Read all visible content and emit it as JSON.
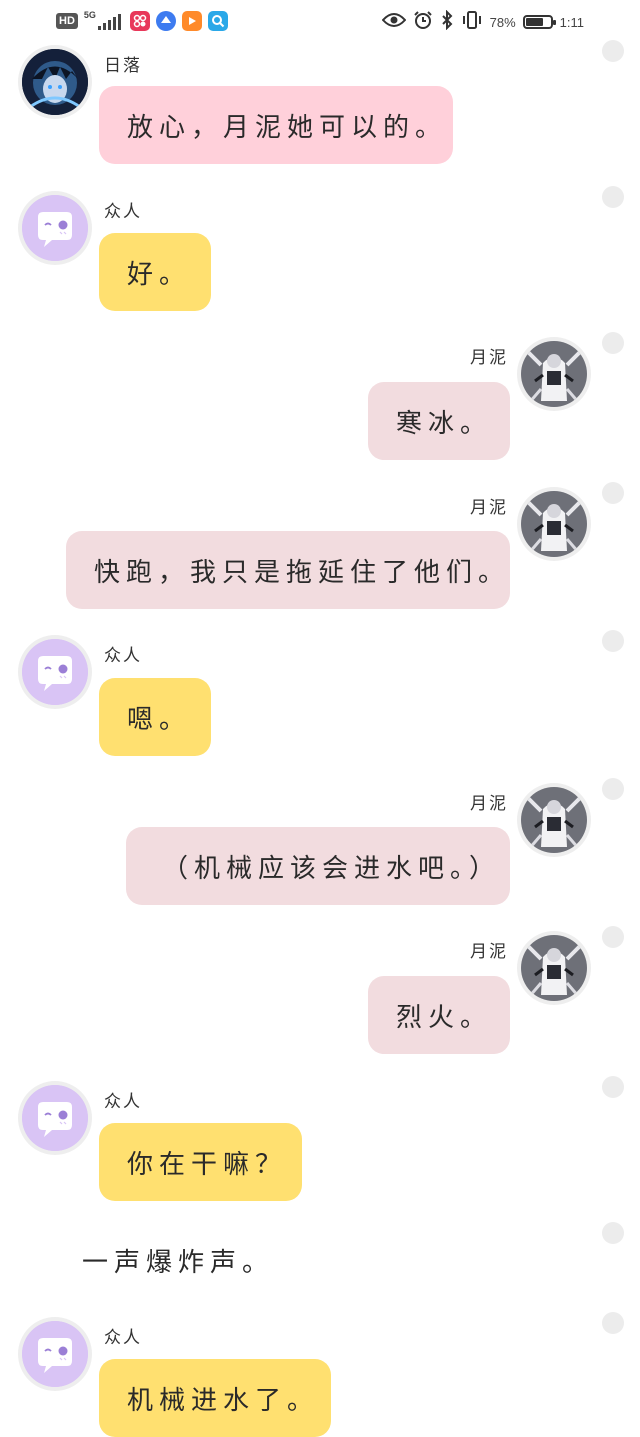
{
  "status_bar": {
    "hd": "HD",
    "network": "5G",
    "battery_pct": "78%",
    "battery_level": 0.78,
    "clock": "1:11",
    "icons": [
      "eye-icon",
      "alarm-icon",
      "bluetooth-icon",
      "vibrate-icon"
    ]
  },
  "messages": [
    {
      "speaker": "日落",
      "text": "放心，月泥她可以的。"
    },
    {
      "speaker": "众人",
      "text": "好。"
    },
    {
      "speaker": "月泥",
      "text": "寒冰。"
    },
    {
      "speaker": "月泥",
      "text": "快跑，我只是拖延住了他们。"
    },
    {
      "speaker": "众人",
      "text": "嗯。"
    },
    {
      "speaker": "月泥",
      "text": "（机械应该会进水吧。）"
    },
    {
      "speaker": "月泥",
      "text": "烈火。"
    },
    {
      "speaker": "众人",
      "text": "你在干嘛？"
    },
    {
      "speaker": "众人",
      "text": "机械进水了。"
    }
  ],
  "narration": "一声爆炸声。",
  "colors": {
    "pink_bubble": "#ffd0da",
    "yellow_bubble": "#ffe070",
    "rose_bubble": "#f2dcdf",
    "group_avatar": "#d9c4f5"
  }
}
